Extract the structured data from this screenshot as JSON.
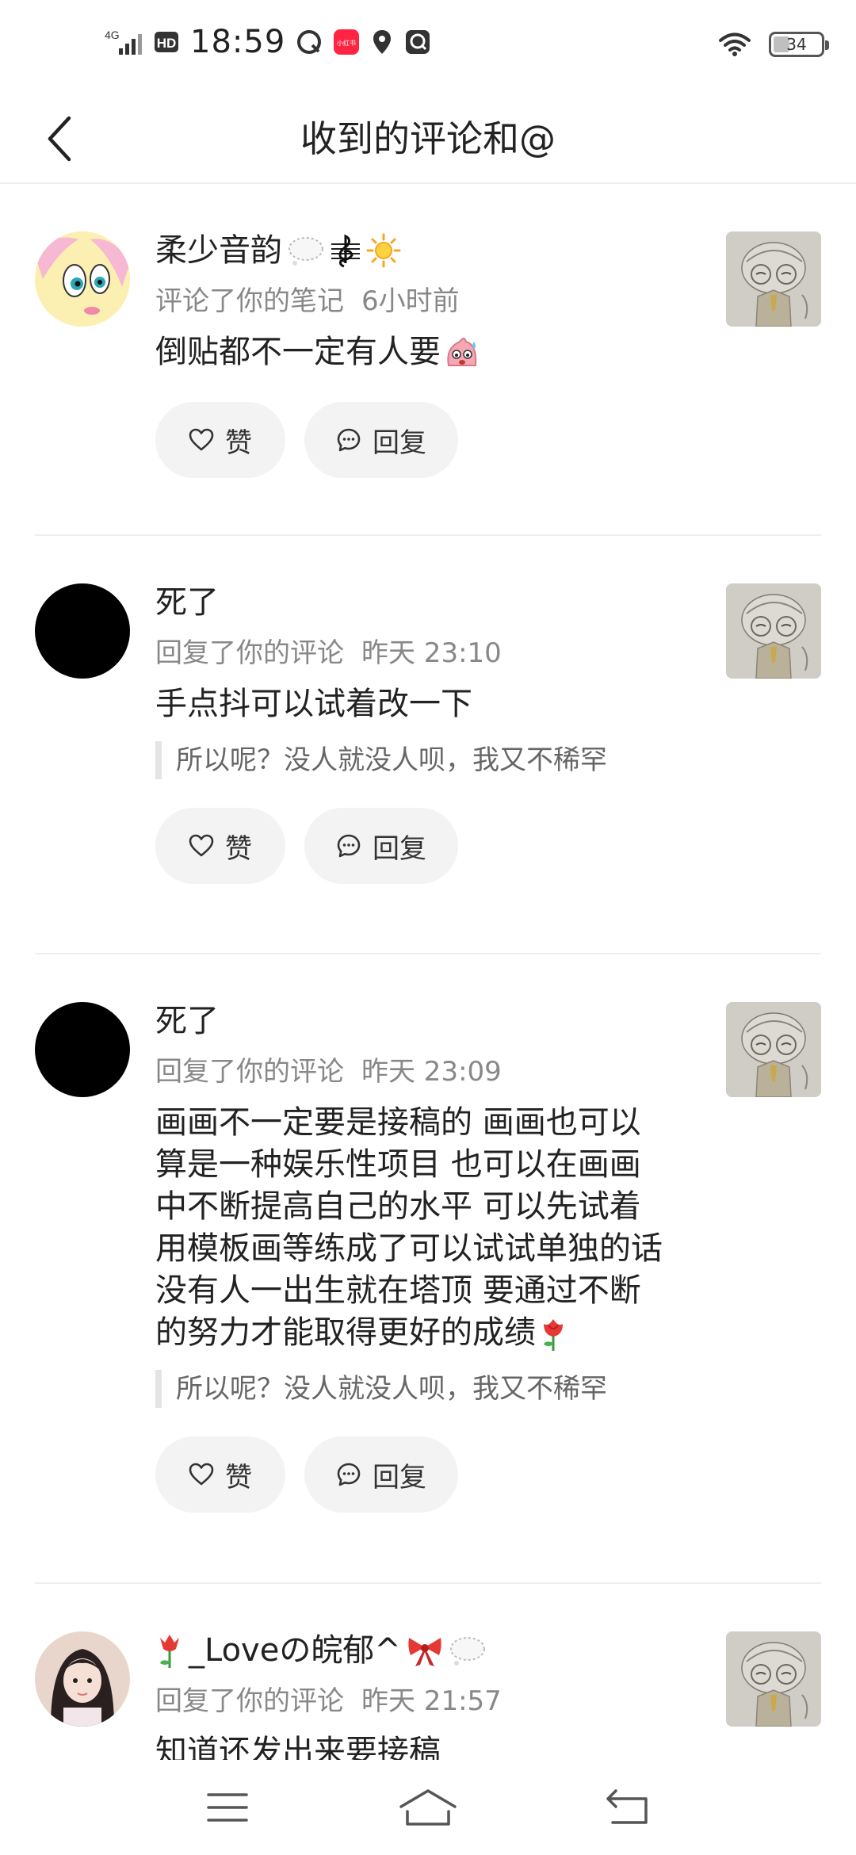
{
  "status_bar": {
    "network": "4G",
    "hd": "HD",
    "time": "18:59",
    "app_badge": "小红书",
    "battery": "34",
    "battery_level": 0.34
  },
  "header": {
    "title": "收到的评论和@"
  },
  "items": [
    {
      "username": "柔少音韵",
      "action": "评论了你的笔记",
      "time": "6小时前",
      "comment": "倒贴都不一定有人要",
      "like_label": "赞",
      "reply_label": "回复"
    },
    {
      "username": "死了",
      "action": "回复了你的评论",
      "time": "昨天 23:10",
      "comment": "手点抖可以试着改一下",
      "quote": "所以呢？没人就没人呗，我又不稀罕",
      "like_label": "赞",
      "reply_label": "回复"
    },
    {
      "username": "死了",
      "action": "回复了你的评论",
      "time": "昨天 23:09",
      "comment_lines": [
        "画画不一定要是接稿的 画画也可以",
        "算是一种娱乐性项目 也可以在画画",
        "中不断提高自己的水平 可以先试着",
        "用模板画等练成了可以试试单独的话",
        "没有人一出生就在塔顶 要通过不断",
        "的努力才能取得更好的成绩"
      ],
      "quote": "所以呢？没人就没人呗，我又不稀罕",
      "like_label": "赞",
      "reply_label": "回复"
    },
    {
      "username": "_Loveの皖郁^",
      "action": "回复了你的评论",
      "time": "昨天 21:57",
      "comment": "知道还发出来要接稿"
    }
  ],
  "colors": {
    "text": "#222222",
    "meta": "#888888",
    "pill_bg": "#f3f3f3",
    "divider": "#eeeeee"
  }
}
